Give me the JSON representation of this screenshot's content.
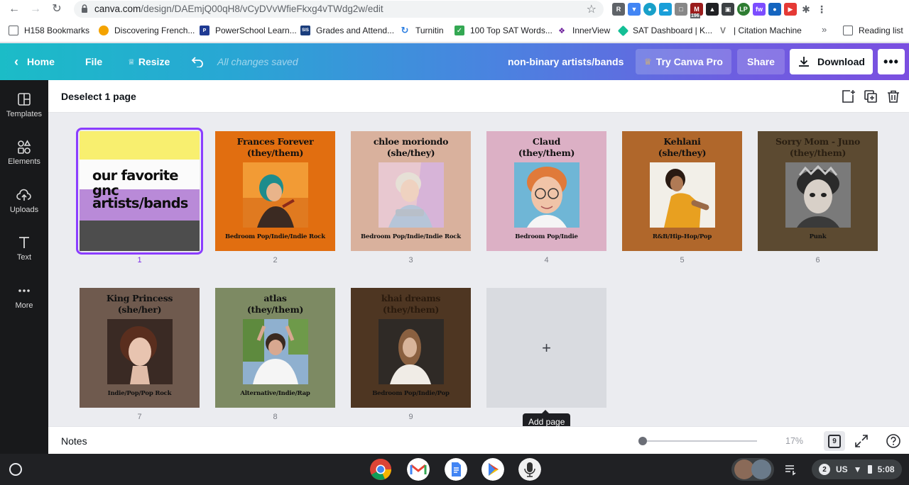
{
  "browser": {
    "url_host": "canva.com",
    "url_path": "/design/DAEmjQ00qH8/vCyDVvWfieFkxg4vTWdg2w/edit",
    "extension_badge": "196",
    "bookmarks": [
      {
        "label": "H158 Bookmarks",
        "icon": "folder-icon",
        "color": "#5f6368"
      },
      {
        "label": "Discovering French...",
        "icon": "circle-icon",
        "color": "#f4a300"
      },
      {
        "label": "PowerSchool Learn...",
        "icon": "powerschool-icon",
        "color": "#1f3a93"
      },
      {
        "label": "Grades and Attend...",
        "icon": "sis-icon",
        "color": "#1a3d7c"
      },
      {
        "label": "Turnitin",
        "icon": "turnitin-icon",
        "color": "#2a7de1"
      },
      {
        "label": "100 Top SAT Words...",
        "icon": "check-icon",
        "color": "#34a853"
      },
      {
        "label": "InnerView",
        "icon": "innerview-icon",
        "color": "#6a1b9a"
      },
      {
        "label": "SAT Dashboard | K...",
        "icon": "khan-icon",
        "color": "#14bf96"
      },
      {
        "label": "| Citation Machine",
        "icon": "citation-icon",
        "color": "#7a7a7a"
      }
    ],
    "reading_list": "Reading list"
  },
  "topbar": {
    "home": "Home",
    "file": "File",
    "resize": "Resize",
    "saved_status": "All changes saved",
    "design_title": "non-binary artists/bands",
    "try_pro": "Try Canva Pro",
    "share": "Share",
    "download": "Download"
  },
  "rail": [
    {
      "label": "Templates",
      "icon": "templates-icon"
    },
    {
      "label": "Elements",
      "icon": "elements-icon"
    },
    {
      "label": "Uploads",
      "icon": "uploads-icon"
    },
    {
      "label": "Text",
      "icon": "text-icon"
    },
    {
      "label": "More",
      "icon": "more-icon"
    }
  ],
  "subbar": {
    "deselect": "Deselect 1 page"
  },
  "cover": {
    "line1": "our favorite",
    "line2": "gnc",
    "line3": "artists/bands",
    "number": "1",
    "stripes": [
      "#f8ef6f",
      "#fbfbfb",
      "#b98ad8",
      "#4d4d4d"
    ]
  },
  "pages": [
    {
      "name": "Frances Forever",
      "pronouns": "(they/them)",
      "genre": "Bedroom Pop/Indie/Indie Rock",
      "number": "2",
      "bg": "#e16e10",
      "photo_bg": "#f29b35",
      "title_color": "#111"
    },
    {
      "name": "chloe moriondo",
      "pronouns": "(she/they)",
      "genre": "Bedroom Pop/Indie/Indie Rock",
      "number": "3",
      "bg": "#d9b19d",
      "photo_bg": "#e8c8d0",
      "title_color": "#111"
    },
    {
      "name": "Claud",
      "pronouns": "(they/them)",
      "genre": "Bedroom Pop/Indie",
      "number": "4",
      "bg": "#dcb0c5",
      "photo_bg": "#6fb6d6",
      "title_color": "#111"
    },
    {
      "name": "Kehlani",
      "pronouns": "(she/they)",
      "genre": "R&B/Hip-Hop/Pop",
      "number": "5",
      "bg": "#b0672b",
      "photo_bg": "#f2efe8",
      "title_color": "#111"
    },
    {
      "name": "Sorry Mom - Juno",
      "pronouns": "(they/them)",
      "genre": "Punk",
      "number": "6",
      "bg": "#5c4a31",
      "photo_bg": "#7a7a7a",
      "title_color": "#2a1f12"
    },
    {
      "name": "King Princess",
      "pronouns": "(she/her)",
      "genre": "Indie/Pop/Pop Rock",
      "number": "7",
      "bg": "#6f5a4e",
      "photo_bg": "#3a2a24",
      "title_color": "#111"
    },
    {
      "name": "atlas",
      "pronouns": "(they/them)",
      "genre": "Alternative/Indie/Rap",
      "number": "8",
      "bg": "#7d8a63",
      "photo_bg": "#8fb0cf",
      "title_color": "#111"
    },
    {
      "name": "khai dreams",
      "pronouns": "(they/them)",
      "genre": "Bedroom Pop/Indie/Pop",
      "number": "9",
      "bg": "#4e3622",
      "photo_bg": "#2f2a26",
      "title_color": "#2a1a0d"
    }
  ],
  "add_page": {
    "tooltip": "Add page"
  },
  "footer": {
    "notes": "Notes",
    "zoom": "17%",
    "zoom_fraction": 0.0,
    "page_count": "9"
  },
  "shelf": {
    "notification_count": "2",
    "locale": "US",
    "time": "5:08"
  }
}
